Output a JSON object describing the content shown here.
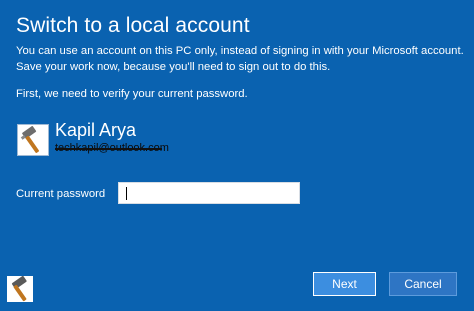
{
  "title": "Switch to a local account",
  "intro": "You can use an account on this PC only, instead of signing in with your Microsoft account. Save your work now, because you'll need to sign out to do this.",
  "verify_text": "First, we need to verify your current password.",
  "user": {
    "name": "Kapil Arya",
    "email": "techkapil@outlook.com",
    "avatar_icon": "hammer-icon"
  },
  "password": {
    "label": "Current password",
    "value": ""
  },
  "buttons": {
    "next": "Next",
    "cancel": "Cancel"
  },
  "colors": {
    "background": "#0a62b0",
    "next_button": "#3c8ee0",
    "cancel_button": "#2e75c4"
  }
}
